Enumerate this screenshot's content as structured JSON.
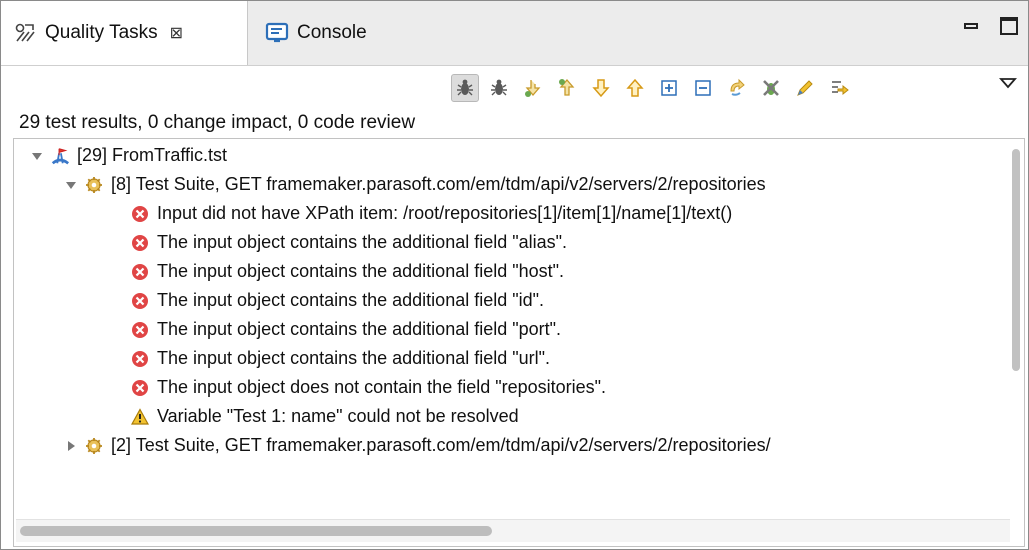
{
  "tabs": [
    {
      "label": "Quality Tasks",
      "icon": "quality-tasks-icon",
      "active": true,
      "close": "⊠"
    },
    {
      "label": "Console",
      "icon": "console-icon",
      "active": false
    }
  ],
  "toolbar": {
    "tools": [
      "bug-filter-icon",
      "bug-icon",
      "expand-down-icon",
      "expand-up-icon",
      "next-icon",
      "previous-icon",
      "expand-all-icon",
      "collapse-all-icon",
      "refresh-icon",
      "remove-icon",
      "edit-icon",
      "import-icon"
    ],
    "view_menu_icon": "view-menu-icon"
  },
  "summary": "29 test results, 0 change impact, 0 code review",
  "tree": {
    "root": {
      "label": "[29] FromTraffic.tst",
      "icon": "test-file-icon"
    },
    "suite1": {
      "label": "[8] Test Suite, GET framemaker.parasoft.com/em/tdm/api/v2/servers/2/repositories"
    },
    "items": [
      {
        "type": "error",
        "label": "Input did not have XPath item: /root/repositories[1]/item[1]/name[1]/text()"
      },
      {
        "type": "error",
        "label": "The input object  contains the additional field \"alias\"."
      },
      {
        "type": "error",
        "label": "The input object  contains the additional field \"host\"."
      },
      {
        "type": "error",
        "label": "The input object  contains the additional field \"id\"."
      },
      {
        "type": "error",
        "label": "The input object  contains the additional field \"port\"."
      },
      {
        "type": "error",
        "label": "The input object  contains the additional field \"url\"."
      },
      {
        "type": "error",
        "label": "The input object  does not contain the field \"repositories\"."
      },
      {
        "type": "warning",
        "label": "Variable \"Test 1: name\" could not be resolved"
      }
    ],
    "suite2": {
      "label": "[2] Test Suite, GET framemaker.parasoft.com/em/tdm/api/v2/servers/2/repositories/"
    }
  },
  "colors": {
    "error": "#e04545",
    "warning": "#f2c230",
    "gear": "#d9a72a"
  }
}
